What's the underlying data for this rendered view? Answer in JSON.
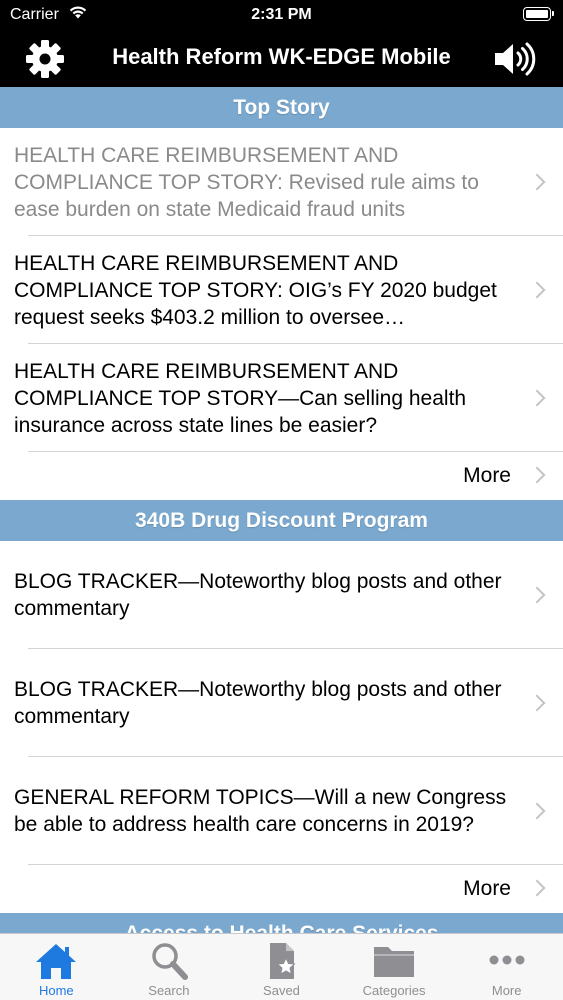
{
  "status_bar": {
    "carrier": "Carrier",
    "time": "2:31 PM"
  },
  "nav": {
    "title": "Health Reform WK-EDGE Mobile",
    "left_icon": "gear-icon",
    "right_icon": "speaker-icon"
  },
  "sections": [
    {
      "title": "Top Story",
      "stories": [
        {
          "text": "HEALTH CARE REIMBURSEMENT AND COMPLIANCE TOP STORY: Revised rule aims to ease burden on state Medicaid fraud units",
          "visited": true
        },
        {
          "text": "HEALTH CARE REIMBURSEMENT AND COMPLIANCE TOP STORY: OIG’s FY 2020 budget request seeks $403.2 million to oversee…",
          "visited": false
        },
        {
          "text": "HEALTH CARE REIMBURSEMENT AND COMPLIANCE TOP STORY—Can selling health insurance across state lines be easier?",
          "visited": false
        }
      ],
      "more_label": "More"
    },
    {
      "title": "340B Drug Discount Program",
      "stories": [
        {
          "text": "BLOG TRACKER—Noteworthy blog posts and other commentary",
          "visited": false
        },
        {
          "text": "BLOG TRACKER—Noteworthy blog posts and other commentary",
          "visited": false
        },
        {
          "text": "GENERAL REFORM TOPICS—Will a new Congress be able to address health care concerns in 2019?",
          "visited": false
        }
      ],
      "more_label": "More"
    },
    {
      "title": "Access to Health Care Services"
    }
  ],
  "tab_bar": {
    "active": "Home",
    "tabs": [
      {
        "label": "Home",
        "icon": "home-icon"
      },
      {
        "label": "Search",
        "icon": "search-icon"
      },
      {
        "label": "Saved",
        "icon": "saved-icon"
      },
      {
        "label": "Categories",
        "icon": "folder-icon"
      },
      {
        "label": "More",
        "icon": "more-icon"
      }
    ]
  },
  "colors": {
    "section_header": "#7aa8cf",
    "tab_active": "#1f7ae0",
    "tab_inactive": "#8e8e93",
    "visited_text": "#8a8a8a"
  }
}
